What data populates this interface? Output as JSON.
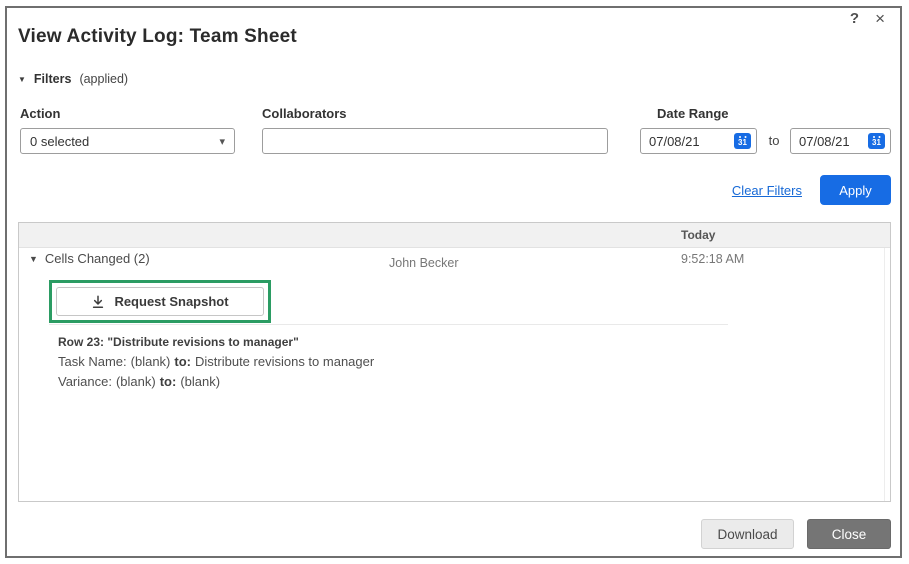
{
  "window": {
    "title": "View Activity Log: Team Sheet",
    "icons": {
      "help": "?",
      "close": "×"
    }
  },
  "filters": {
    "expander_icon": "▼",
    "label": "Filters",
    "status": "(applied)",
    "action_label": "Action",
    "action_value": "0 selected",
    "action_caret": "▾",
    "collaborators_label": "Collaborators",
    "collaborators_value": "",
    "date_range_label": "Date Range",
    "date_from": "07/08/21",
    "to_label": "to",
    "date_to": "07/08/21",
    "calendar_day": "31",
    "clear_label": "Clear Filters",
    "apply_label": "Apply"
  },
  "log": {
    "day_header": "Today",
    "entry": {
      "expander_icon": "▼",
      "title": "Cells Changed (2)",
      "user": "John Becker",
      "time": "9:52:18 AM",
      "snapshot_label": "Request Snapshot",
      "row_header": "Row 23: \"Distribute revisions to manager\"",
      "changes": [
        {
          "field": "Task Name:",
          "from": "(blank)",
          "to_label": "to:",
          "to": "Distribute revisions to manager"
        },
        {
          "field": "Variance:",
          "from": "(blank)",
          "to_label": "to:",
          "to": "(blank)"
        }
      ]
    }
  },
  "footer": {
    "download_label": "Download",
    "close_label": "Close"
  },
  "colors": {
    "accent_blue": "#176CE4",
    "link_blue": "#1769D6",
    "highlight_green": "#2B9C63",
    "close_button_gray": "#757575"
  }
}
